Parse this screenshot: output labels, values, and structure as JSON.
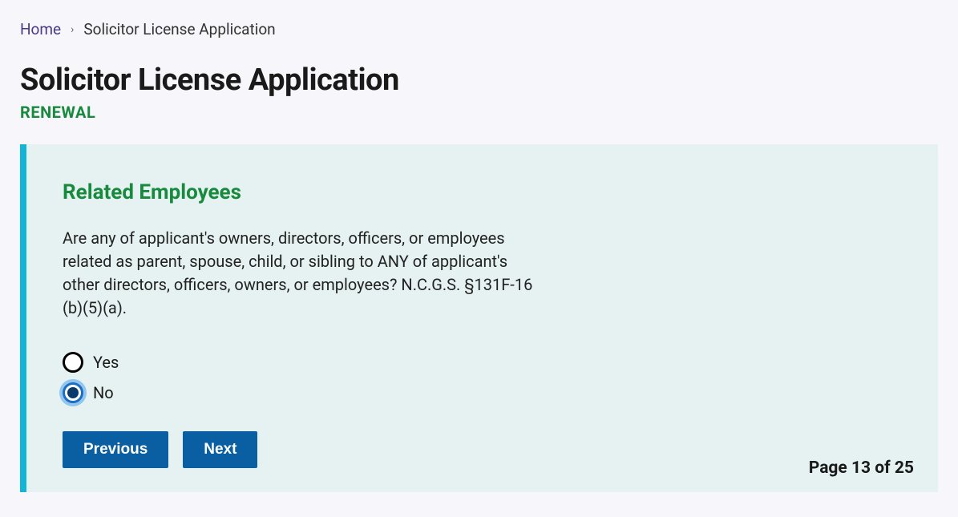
{
  "breadcrumb": {
    "home": "Home",
    "current": "Solicitor License Application"
  },
  "header": {
    "title": "Solicitor License Application",
    "subtitle": "RENEWAL"
  },
  "section": {
    "title": "Related Employees",
    "question": "Are any of applicant's owners, directors, officers, or employees related as parent, spouse, child, or sibling to ANY of applicant's other directors, officers, owners, or employees? N.C.G.S. §131F-16 (b)(5)(a)."
  },
  "options": {
    "yes": "Yes",
    "no": "No",
    "selected": "no"
  },
  "buttons": {
    "previous": "Previous",
    "next": "Next"
  },
  "pagination": {
    "text": "Page 13 of 25"
  }
}
